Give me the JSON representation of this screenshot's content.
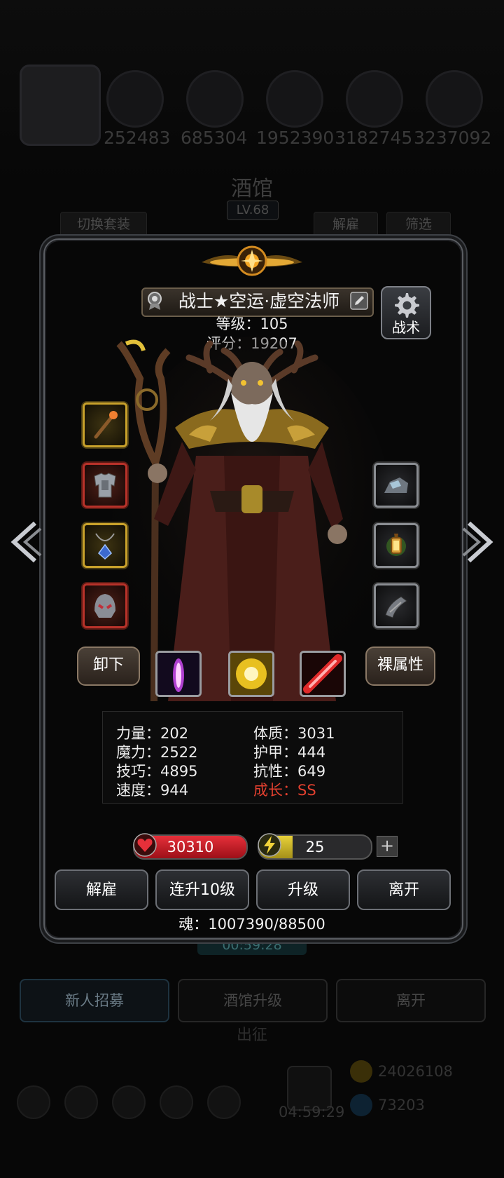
{
  "background": {
    "power_values": [
      "252483",
      "685304",
      "1952390",
      "3182745",
      "3237092"
    ],
    "tavern_title": "酒馆",
    "tavern_level": "LV.68",
    "tabs": {
      "switch_set": "切换套装",
      "dismiss": "解雇",
      "filter": "筛选"
    },
    "timer": "00:59:28",
    "bottom_buttons": {
      "recruit": "新人招募",
      "upgrade_tavern": "酒馆升级",
      "leave": "离开"
    },
    "expedition": "出征",
    "gold": "24026108",
    "gem": "73203",
    "gift_timer": "04:59:29"
  },
  "hero": {
    "name": "战士★空运·虚空法师",
    "level_line": "等级：105",
    "score_line": "评分：19207",
    "tactic_label": "战术",
    "unequip_label": "卸下",
    "raw_attr_label": "裸属性"
  },
  "attributes": {
    "strength": "力量：202",
    "magic": "魔力：2522",
    "skill": "技巧：4895",
    "speed": "速度：944",
    "constitution": "体质：3031",
    "armor": "护甲：444",
    "resistance": "抗性：649",
    "growth": "成长：SS"
  },
  "bars": {
    "hp": "30310",
    "hp_fraction": 1.0,
    "energy": "25",
    "energy_fraction": 0.3,
    "energy_add": "+"
  },
  "actions": {
    "dismiss": "解雇",
    "level_up_10": "连升10级",
    "level_up": "升级",
    "leave": "离开"
  },
  "soul": "魂：1007390/88500",
  "colors": {
    "gold_frame": "#c8a12b",
    "red_frame": "#b8322a",
    "growth_red": "#e2402f",
    "hp_red": "#e6303a",
    "energy_yellow": "#e8d13a"
  },
  "icons": {
    "equipment_left": [
      "staff-icon",
      "armor-icon",
      "amulet-icon",
      "helmet-icon"
    ],
    "equipment_right": [
      "stone-icon",
      "lantern-icon",
      "bracer-icon"
    ],
    "skills": [
      "purple-flame-skill-icon",
      "golden-burst-skill-icon",
      "red-slash-skill-icon"
    ]
  }
}
